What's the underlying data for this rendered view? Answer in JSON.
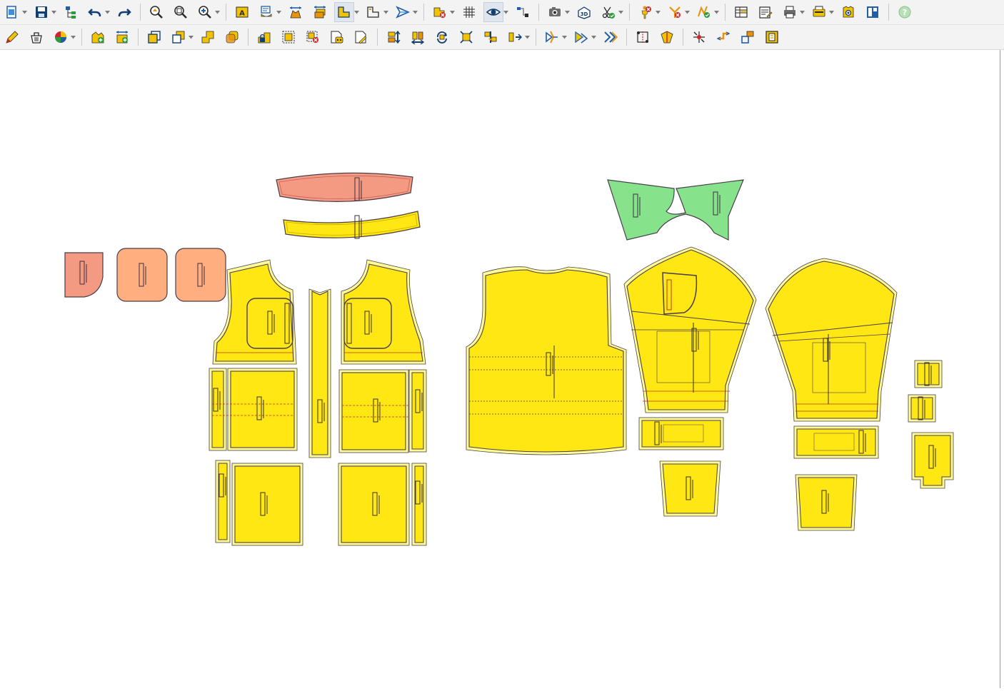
{
  "colors": {
    "piece_fill": "#ffe714",
    "piece_outline": "#fffb95",
    "piece_stroke": "#4a3d4d",
    "collar_fill": "#86e38b",
    "band_fill": "#f59a82",
    "pocket_fill": "#ffaf7f",
    "seam_red": "#c2331f"
  },
  "toolbar_row1": [
    {
      "icon": "new-document-icon",
      "dropdown": true
    },
    {
      "icon": "save-icon",
      "dropdown": true
    },
    {
      "icon": "hierarchy-icon",
      "dropdown": false
    },
    {
      "icon": "undo-icon",
      "dropdown": true
    },
    {
      "icon": "redo-icon",
      "dropdown": false
    },
    {
      "sep": true
    },
    {
      "icon": "zoom-fit-icon",
      "dropdown": false
    },
    {
      "icon": "zoom-window-icon",
      "dropdown": false
    },
    {
      "icon": "zoom-in-icon",
      "dropdown": true
    },
    {
      "sep": true
    },
    {
      "icon": "text-label-icon",
      "dropdown": false
    },
    {
      "icon": "annotation-icon",
      "dropdown": true
    },
    {
      "icon": "measure-width-icon",
      "dropdown": false
    },
    {
      "icon": "measure-height-icon",
      "dropdown": false
    },
    {
      "icon": "piece-shape-icon",
      "dropdown": true,
      "pressed": true
    },
    {
      "icon": "piece-outline-icon",
      "dropdown": true
    },
    {
      "icon": "arrow-tool-icon",
      "dropdown": true
    },
    {
      "sep": true
    },
    {
      "icon": "delete-piece-icon",
      "dropdown": true
    },
    {
      "icon": "grid-icon",
      "dropdown": false
    },
    {
      "icon": "eye-icon",
      "dropdown": true,
      "pressed": true
    },
    {
      "icon": "connect-icon",
      "dropdown": false
    },
    {
      "sep": true
    },
    {
      "icon": "camera-icon",
      "dropdown": true
    },
    {
      "icon": "3d-view-icon",
      "dropdown": false
    },
    {
      "icon": "scissors-check-icon",
      "dropdown": true
    },
    {
      "sep": true
    },
    {
      "icon": "person-cancel-icon",
      "dropdown": true
    },
    {
      "icon": "pin-cancel-icon",
      "dropdown": true
    },
    {
      "icon": "pattern-check-icon",
      "dropdown": true
    },
    {
      "sep": true
    },
    {
      "icon": "table-report-icon",
      "dropdown": false
    },
    {
      "icon": "edit-report-icon",
      "dropdown": false
    },
    {
      "icon": "print-icon",
      "dropdown": true
    },
    {
      "icon": "plot-icon",
      "dropdown": true
    },
    {
      "icon": "garment-view-icon",
      "dropdown": false
    },
    {
      "icon": "panel-icon",
      "dropdown": false
    },
    {
      "sep": true
    },
    {
      "icon": "help-icon",
      "dropdown": false
    }
  ],
  "toolbar_row2": [
    {
      "icon": "pencil-icon",
      "dropdown": false
    },
    {
      "icon": "basket-icon",
      "dropdown": false
    },
    {
      "icon": "color-wheel-icon",
      "dropdown": true
    },
    {
      "sep": true
    },
    {
      "icon": "add-piece-icon",
      "dropdown": false
    },
    {
      "icon": "add-piece-width-icon",
      "dropdown": false
    },
    {
      "sep": true
    },
    {
      "icon": "copy-piece-icon",
      "dropdown": false
    },
    {
      "icon": "duplicate-piece-icon",
      "dropdown": true
    },
    {
      "icon": "merge-piece-icon",
      "dropdown": false
    },
    {
      "icon": "overlap-piece-icon",
      "dropdown": false
    },
    {
      "sep": true
    },
    {
      "icon": "lock-piece-icon",
      "dropdown": false
    },
    {
      "icon": "group-select-icon",
      "dropdown": false
    },
    {
      "icon": "group-cancel-icon",
      "dropdown": false
    },
    {
      "icon": "piece-info-icon",
      "dropdown": false
    },
    {
      "icon": "piece-edit-icon",
      "dropdown": false
    },
    {
      "sep": true
    },
    {
      "icon": "flip-vertical-icon",
      "dropdown": false
    },
    {
      "icon": "flip-horizontal-icon",
      "dropdown": false
    },
    {
      "icon": "rotate-icon",
      "dropdown": false
    },
    {
      "icon": "scale-icon",
      "dropdown": false
    },
    {
      "icon": "align-icon",
      "dropdown": false
    },
    {
      "icon": "distribute-icon",
      "dropdown": true
    },
    {
      "sep": true
    },
    {
      "icon": "shift-left-icon",
      "dropdown": true
    },
    {
      "icon": "shift-up-icon",
      "dropdown": true
    },
    {
      "icon": "fast-forward-icon",
      "dropdown": false
    },
    {
      "sep": true
    },
    {
      "icon": "cut-line-icon",
      "dropdown": false
    },
    {
      "icon": "split-piece-icon",
      "dropdown": false
    },
    {
      "sep": true
    },
    {
      "icon": "add-point-icon",
      "dropdown": false
    },
    {
      "icon": "move-point-icon",
      "dropdown": false
    },
    {
      "icon": "resize-corner-icon",
      "dropdown": false
    },
    {
      "icon": "frame-icon",
      "dropdown": false
    }
  ]
}
